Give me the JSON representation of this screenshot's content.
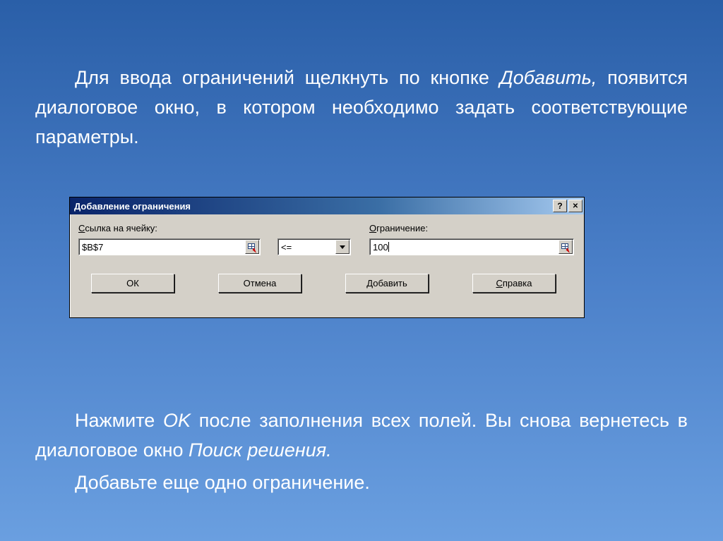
{
  "slide": {
    "top": {
      "p1_a": "Для ввода ограничений щелкнуть по кнопке ",
      "p1_b_ital": "Добавить,",
      "p1_c": " появится диалоговое окно, в котором необходимо задать соответствующие параметры."
    },
    "bottom": {
      "p2_a": "Нажмите ",
      "p2_b_ital": "OK",
      "p2_c": " после заполнения всех полей. Вы снова вернетесь в диалоговое окно ",
      "p2_d_ital": "Поиск решения.",
      "p3": "Добавьте еще одно ограничение."
    }
  },
  "dialog": {
    "title": "Добавление ограничения",
    "help_symbol": "?",
    "close_symbol": "✕",
    "labels": {
      "cell_ref_prefix": "С",
      "cell_ref_rest": "сылка на ячейку:",
      "constraint_prefix": "О",
      "constraint_rest": "граничение:"
    },
    "fields": {
      "cell_ref_value": "$B$7",
      "operator_value": "<=",
      "constraint_value": "100"
    },
    "buttons": {
      "ok": "ОК",
      "cancel": "Отмена",
      "add_prefix": "Д",
      "add_rest": "обавить",
      "help_prefix": "С",
      "help_rest": "правка"
    }
  }
}
